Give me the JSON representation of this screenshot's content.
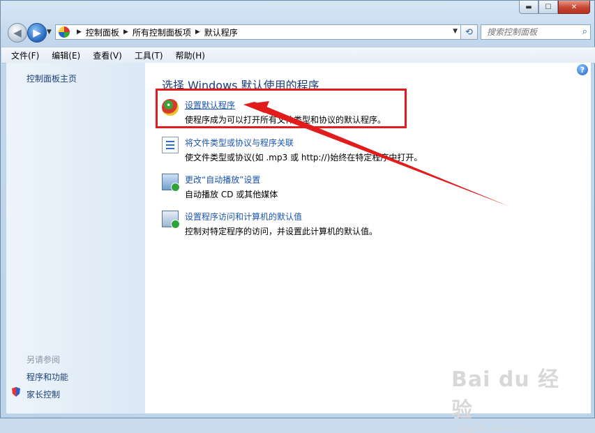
{
  "window": {
    "minimize_label": "▬",
    "maximize_label": "☐",
    "close_label": "✕"
  },
  "nav": {
    "back_icon": "back-arrow",
    "forward_icon": "forward-arrow",
    "breadcrumbs": [
      "控制面板",
      "所有控制面板项",
      "默认程序"
    ],
    "search_placeholder": "搜索控制面板"
  },
  "menu": [
    "文件(F)",
    "编辑(E)",
    "查看(V)",
    "工具(T)",
    "帮助(H)"
  ],
  "sidebar": {
    "home": "控制面板主页",
    "see_also": "另请参阅",
    "links": [
      "程序和功能",
      "家长控制"
    ]
  },
  "main": {
    "title": "选择 Windows 默认使用的程序",
    "entries": [
      {
        "link": "设置默认程序",
        "desc": "使程序成为可以打开所有文件类型和协议的默认程序。",
        "icon": "default-programs-icon"
      },
      {
        "link": "将文件类型或协议与程序关联",
        "desc": "使文件类型或协议(如 .mp3 或 http://)始终在特定程序中打开。",
        "icon": "file-association-icon"
      },
      {
        "link": "更改“自动播放”设置",
        "desc": "自动播放 CD 或其他媒体",
        "icon": "autoplay-icon"
      },
      {
        "link": "设置程序访问和计算机的默认值",
        "desc": "控制对特定程序的访问，并设置此计算机的默认值。",
        "icon": "program-access-icon"
      }
    ]
  },
  "annotation": {
    "highlight_color": "#e01c1c"
  },
  "watermark": {
    "brand": "Bai du 经验",
    "url": "jingyan.baidu.com"
  }
}
